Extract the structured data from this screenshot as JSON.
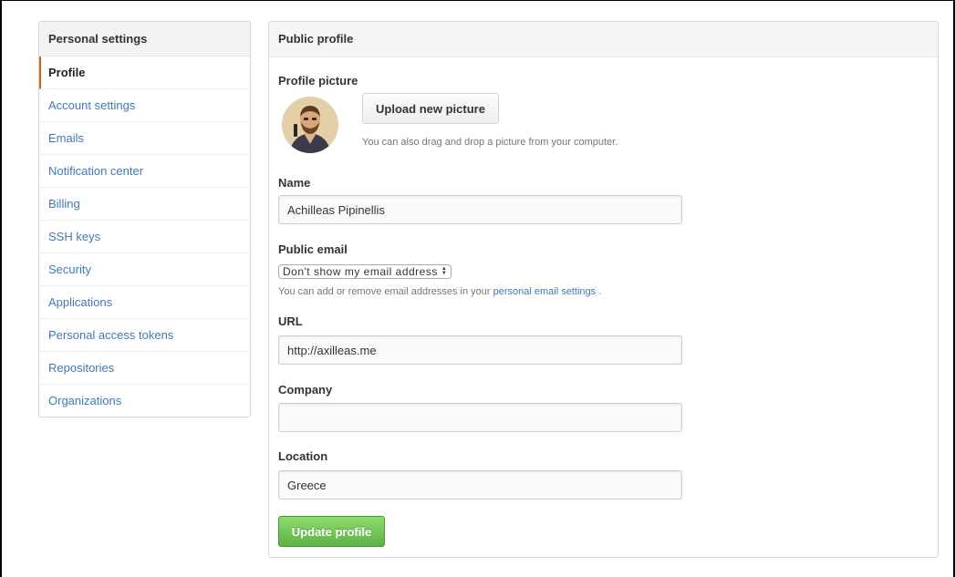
{
  "sidebar": {
    "title": "Personal settings",
    "items": [
      {
        "label": "Profile",
        "selected": true
      },
      {
        "label": "Account settings"
      },
      {
        "label": "Emails"
      },
      {
        "label": "Notification center"
      },
      {
        "label": "Billing"
      },
      {
        "label": "SSH keys"
      },
      {
        "label": "Security"
      },
      {
        "label": "Applications"
      },
      {
        "label": "Personal access tokens"
      },
      {
        "label": "Repositories"
      },
      {
        "label": "Organizations"
      }
    ]
  },
  "main": {
    "title": "Public profile",
    "profile_picture": {
      "label": "Profile picture",
      "upload_label": "Upload new picture",
      "hint": "You can also drag and drop a picture from your computer."
    },
    "name": {
      "label": "Name",
      "value": "Achilleas Pipinellis"
    },
    "public_email": {
      "label": "Public email",
      "selected": "Don't show my email address",
      "hint_prefix": "You can add or remove email addresses in your",
      "hint_link": "personal email settings",
      "hint_suffix": "."
    },
    "url": {
      "label": "URL",
      "value": "http://axilleas.me"
    },
    "company": {
      "label": "Company",
      "value": ""
    },
    "location": {
      "label": "Location",
      "value": "Greece"
    },
    "update_label": "Update profile"
  },
  "colors": {
    "accent": "#d26911",
    "link": "#4078c0",
    "update_button": "#60b044"
  }
}
